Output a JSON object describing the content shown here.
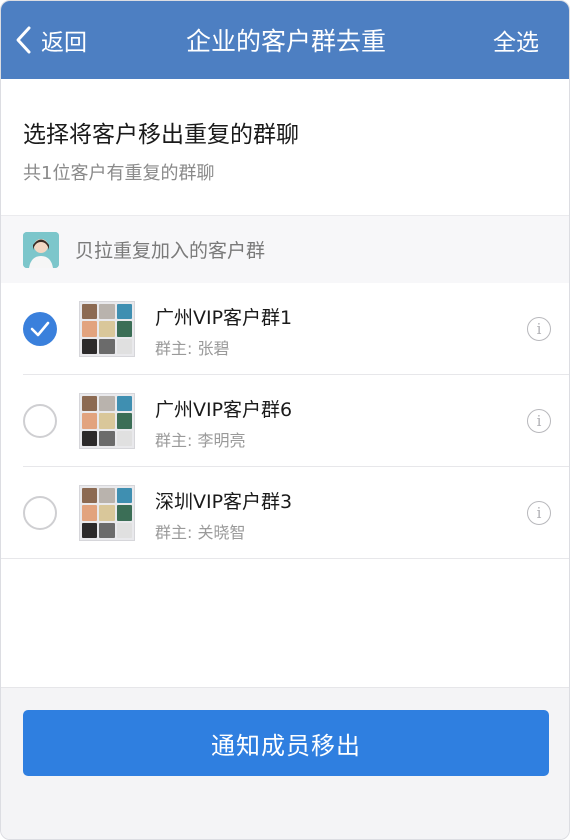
{
  "header": {
    "back_label": "返回",
    "title": "企业的客户群去重",
    "action_label": "全选"
  },
  "intro": {
    "title": "选择将客户移出重复的群聊",
    "subtitle": "共1位客户有重复的群聊"
  },
  "section": {
    "label": "贝拉重复加入的客户群"
  },
  "groups": [
    {
      "name": "广州VIP客户群1",
      "owner": "群主: 张碧",
      "checked": true
    },
    {
      "name": "广州VIP客户群6",
      "owner": "群主: 李明亮",
      "checked": false
    },
    {
      "name": "深圳VIP客户群3",
      "owner": "群主: 关晓智",
      "checked": false
    }
  ],
  "footer": {
    "button_label": "通知成员移出"
  },
  "colors": {
    "navbar": "#4d7fc2",
    "accent": "#2f7fe0",
    "checked": "#3a80dc"
  }
}
